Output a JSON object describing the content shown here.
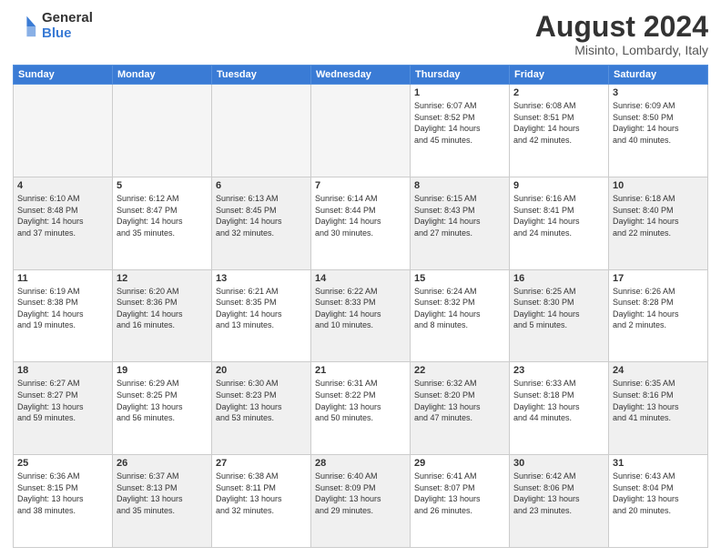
{
  "header": {
    "logo_general": "General",
    "logo_blue": "Blue",
    "title": "August 2024",
    "subtitle": "Misinto, Lombardy, Italy"
  },
  "days_of_week": [
    "Sunday",
    "Monday",
    "Tuesday",
    "Wednesday",
    "Thursday",
    "Friday",
    "Saturday"
  ],
  "weeks": [
    [
      {
        "num": "",
        "info": "",
        "empty": true
      },
      {
        "num": "",
        "info": "",
        "empty": true
      },
      {
        "num": "",
        "info": "",
        "empty": true
      },
      {
        "num": "",
        "info": "",
        "empty": true
      },
      {
        "num": "1",
        "info": "Sunrise: 6:07 AM\nSunset: 8:52 PM\nDaylight: 14 hours\nand 45 minutes."
      },
      {
        "num": "2",
        "info": "Sunrise: 6:08 AM\nSunset: 8:51 PM\nDaylight: 14 hours\nand 42 minutes."
      },
      {
        "num": "3",
        "info": "Sunrise: 6:09 AM\nSunset: 8:50 PM\nDaylight: 14 hours\nand 40 minutes."
      }
    ],
    [
      {
        "num": "4",
        "info": "Sunrise: 6:10 AM\nSunset: 8:48 PM\nDaylight: 14 hours\nand 37 minutes.",
        "shaded": true
      },
      {
        "num": "5",
        "info": "Sunrise: 6:12 AM\nSunset: 8:47 PM\nDaylight: 14 hours\nand 35 minutes."
      },
      {
        "num": "6",
        "info": "Sunrise: 6:13 AM\nSunset: 8:45 PM\nDaylight: 14 hours\nand 32 minutes.",
        "shaded": true
      },
      {
        "num": "7",
        "info": "Sunrise: 6:14 AM\nSunset: 8:44 PM\nDaylight: 14 hours\nand 30 minutes."
      },
      {
        "num": "8",
        "info": "Sunrise: 6:15 AM\nSunset: 8:43 PM\nDaylight: 14 hours\nand 27 minutes.",
        "shaded": true
      },
      {
        "num": "9",
        "info": "Sunrise: 6:16 AM\nSunset: 8:41 PM\nDaylight: 14 hours\nand 24 minutes."
      },
      {
        "num": "10",
        "info": "Sunrise: 6:18 AM\nSunset: 8:40 PM\nDaylight: 14 hours\nand 22 minutes.",
        "shaded": true
      }
    ],
    [
      {
        "num": "11",
        "info": "Sunrise: 6:19 AM\nSunset: 8:38 PM\nDaylight: 14 hours\nand 19 minutes."
      },
      {
        "num": "12",
        "info": "Sunrise: 6:20 AM\nSunset: 8:36 PM\nDaylight: 14 hours\nand 16 minutes.",
        "shaded": true
      },
      {
        "num": "13",
        "info": "Sunrise: 6:21 AM\nSunset: 8:35 PM\nDaylight: 14 hours\nand 13 minutes."
      },
      {
        "num": "14",
        "info": "Sunrise: 6:22 AM\nSunset: 8:33 PM\nDaylight: 14 hours\nand 10 minutes.",
        "shaded": true
      },
      {
        "num": "15",
        "info": "Sunrise: 6:24 AM\nSunset: 8:32 PM\nDaylight: 14 hours\nand 8 minutes."
      },
      {
        "num": "16",
        "info": "Sunrise: 6:25 AM\nSunset: 8:30 PM\nDaylight: 14 hours\nand 5 minutes.",
        "shaded": true
      },
      {
        "num": "17",
        "info": "Sunrise: 6:26 AM\nSunset: 8:28 PM\nDaylight: 14 hours\nand 2 minutes."
      }
    ],
    [
      {
        "num": "18",
        "info": "Sunrise: 6:27 AM\nSunset: 8:27 PM\nDaylight: 13 hours\nand 59 minutes.",
        "shaded": true
      },
      {
        "num": "19",
        "info": "Sunrise: 6:29 AM\nSunset: 8:25 PM\nDaylight: 13 hours\nand 56 minutes."
      },
      {
        "num": "20",
        "info": "Sunrise: 6:30 AM\nSunset: 8:23 PM\nDaylight: 13 hours\nand 53 minutes.",
        "shaded": true
      },
      {
        "num": "21",
        "info": "Sunrise: 6:31 AM\nSunset: 8:22 PM\nDaylight: 13 hours\nand 50 minutes."
      },
      {
        "num": "22",
        "info": "Sunrise: 6:32 AM\nSunset: 8:20 PM\nDaylight: 13 hours\nand 47 minutes.",
        "shaded": true
      },
      {
        "num": "23",
        "info": "Sunrise: 6:33 AM\nSunset: 8:18 PM\nDaylight: 13 hours\nand 44 minutes."
      },
      {
        "num": "24",
        "info": "Sunrise: 6:35 AM\nSunset: 8:16 PM\nDaylight: 13 hours\nand 41 minutes.",
        "shaded": true
      }
    ],
    [
      {
        "num": "25",
        "info": "Sunrise: 6:36 AM\nSunset: 8:15 PM\nDaylight: 13 hours\nand 38 minutes."
      },
      {
        "num": "26",
        "info": "Sunrise: 6:37 AM\nSunset: 8:13 PM\nDaylight: 13 hours\nand 35 minutes.",
        "shaded": true
      },
      {
        "num": "27",
        "info": "Sunrise: 6:38 AM\nSunset: 8:11 PM\nDaylight: 13 hours\nand 32 minutes."
      },
      {
        "num": "28",
        "info": "Sunrise: 6:40 AM\nSunset: 8:09 PM\nDaylight: 13 hours\nand 29 minutes.",
        "shaded": true
      },
      {
        "num": "29",
        "info": "Sunrise: 6:41 AM\nSunset: 8:07 PM\nDaylight: 13 hours\nand 26 minutes."
      },
      {
        "num": "30",
        "info": "Sunrise: 6:42 AM\nSunset: 8:06 PM\nDaylight: 13 hours\nand 23 minutes.",
        "shaded": true
      },
      {
        "num": "31",
        "info": "Sunrise: 6:43 AM\nSunset: 8:04 PM\nDaylight: 13 hours\nand 20 minutes."
      }
    ]
  ]
}
